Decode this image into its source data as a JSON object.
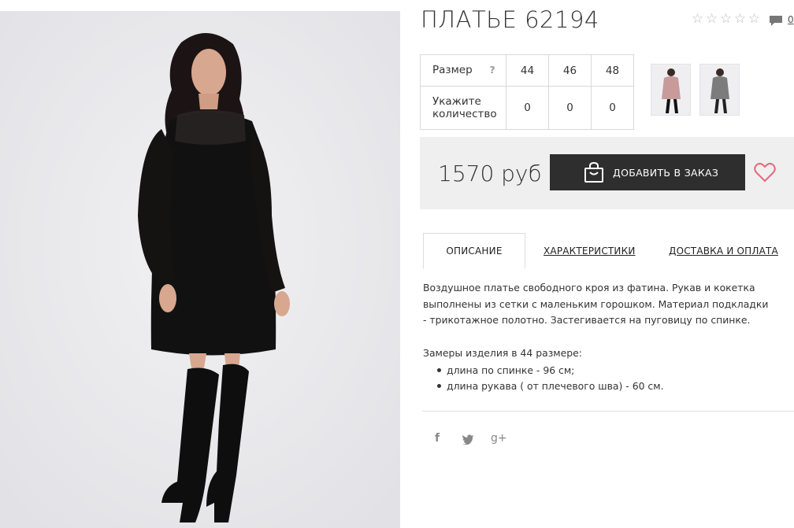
{
  "product": {
    "title": "ПЛАТЬЕ 62194",
    "image_alt": "model-wearing-black-dress",
    "rating_stars": [
      "☆",
      "☆",
      "☆",
      "☆",
      "☆"
    ],
    "comment_count": "0"
  },
  "sizes": {
    "size_label": "Размер",
    "help": "?",
    "qty_label_1": "Укажите",
    "qty_label_2": "количество",
    "columns": [
      "44",
      "46",
      "48"
    ],
    "quantities": [
      "0",
      "0",
      "0"
    ]
  },
  "purchase": {
    "price": "1570 руб",
    "add_button": "ДОБАВИТЬ В ЗАКАЗ"
  },
  "tabs": {
    "description": "ОПИСАНИЕ",
    "characteristics": "ХАРАКТЕРИСТИКИ",
    "delivery": "ДОСТАВКА И ОПЛАТА"
  },
  "content": {
    "description": "Воздушное платье свободного кроя из фатина. Рукав и кокетка выполнены из сетки с маленьким горошком. Материал подкладки - трикотажное полотно. Застегивается на пуговицу по спинке.",
    "measures_title": "Замеры изделия в 44 размере:",
    "measures": [
      "длина по спинке - 96 см;",
      "длина рукава ( от плечевого шва) - 60 см."
    ]
  },
  "social": {
    "facebook": "f",
    "twitter": "twitter-icon",
    "googleplus": "g+"
  },
  "colors": {
    "button_bg": "#2e2e2e",
    "price_bar_bg": "#efefef",
    "heart": "#e06b7a"
  }
}
